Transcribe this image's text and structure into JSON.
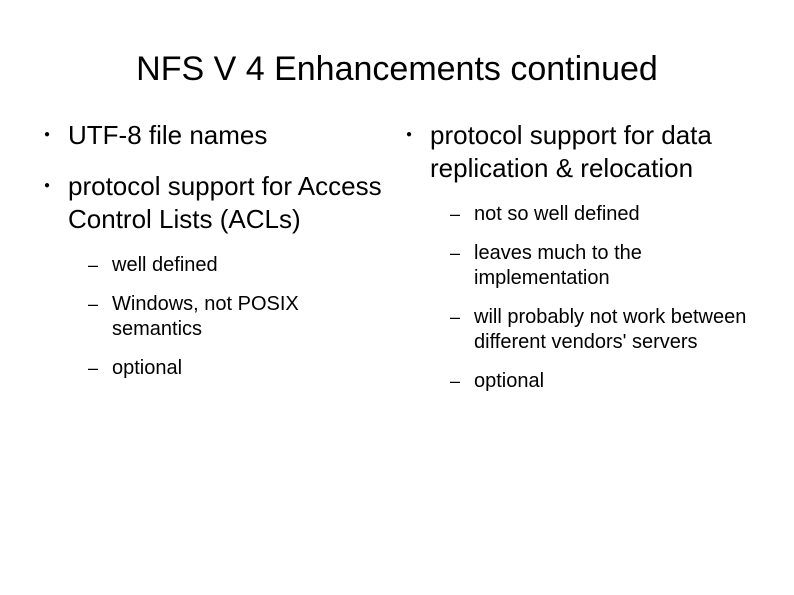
{
  "title": "NFS V 4 Enhancements continued",
  "left": {
    "items": [
      {
        "text": "UTF-8 file names",
        "subs": []
      },
      {
        "text": "protocol support for Access Control Lists (ACLs)",
        "subs": [
          "well defined",
          "Windows, not POSIX semantics",
          "optional"
        ]
      }
    ]
  },
  "right": {
    "items": [
      {
        "text": "protocol support for data replication & relocation",
        "subs": [
          "not so well defined",
          "leaves much to the implementation",
          "will probably not work between different vendors' servers",
          "optional"
        ]
      }
    ]
  }
}
